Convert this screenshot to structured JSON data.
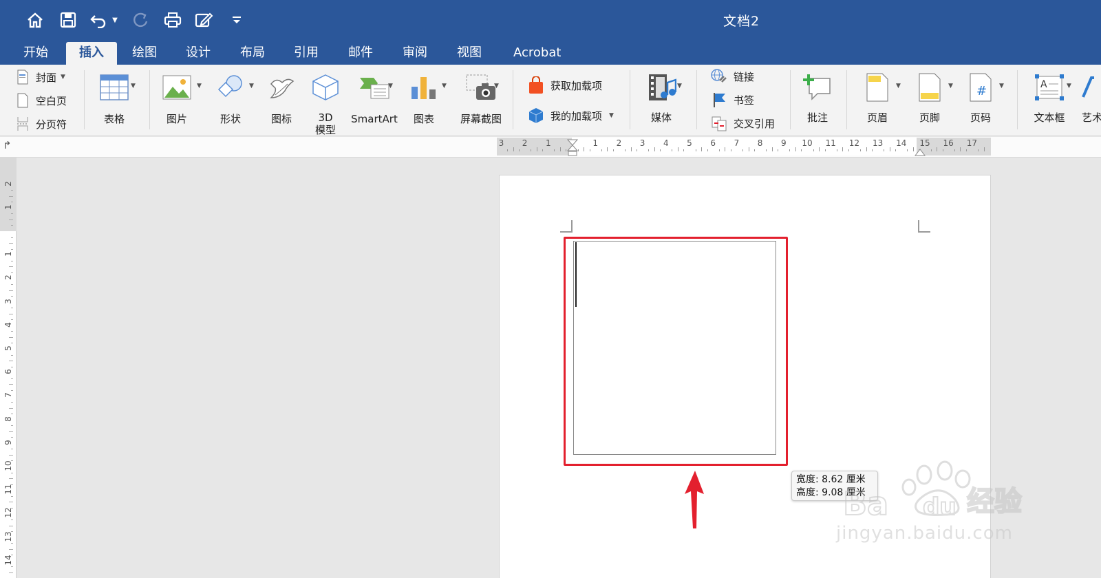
{
  "window": {
    "title": "文档2"
  },
  "quick_access": {
    "icons": [
      "home-icon",
      "save-icon",
      "undo-icon",
      "undo-dropdown-icon",
      "redo-icon",
      "print-icon",
      "edit-icon",
      "customize-icon"
    ]
  },
  "tabs": [
    {
      "label": "开始",
      "active": false
    },
    {
      "label": "插入",
      "active": true
    },
    {
      "label": "绘图",
      "active": false
    },
    {
      "label": "设计",
      "active": false
    },
    {
      "label": "布局",
      "active": false
    },
    {
      "label": "引用",
      "active": false
    },
    {
      "label": "邮件",
      "active": false
    },
    {
      "label": "审阅",
      "active": false
    },
    {
      "label": "视图",
      "active": false
    },
    {
      "label": "Acrobat",
      "active": false
    }
  ],
  "ribbon": {
    "pages_group": {
      "cover": "封面",
      "blank": "空白页",
      "page_break": "分页符"
    },
    "table": "表格",
    "picture": "图片",
    "shapes": "形状",
    "icons": "图标",
    "model3d_line1": "3D",
    "model3d_line2": "模型",
    "smartart": "SmartArt",
    "chart": "图表",
    "screenshot": "屏幕截图",
    "get_addins": "获取加载项",
    "my_addins": "我的加载项",
    "media": "媒体",
    "link": "链接",
    "bookmark": "书签",
    "cross_ref": "交叉引用",
    "comment": "批注",
    "header": "页眉",
    "footer": "页脚",
    "page_number": "页码",
    "textbox": "文本框",
    "wordart": "艺术"
  },
  "ruler": {
    "h_numbers": [
      "3",
      "2",
      "1",
      "1",
      "2",
      "3",
      "4",
      "5",
      "6",
      "7",
      "8",
      "9",
      "10",
      "11",
      "12",
      "13",
      "14",
      "15",
      "16",
      "17"
    ],
    "v_numbers": [
      "2",
      "1",
      "1",
      "2",
      "3",
      "4",
      "5",
      "6",
      "7",
      "8",
      "9",
      "10",
      "11",
      "12",
      "13",
      "14"
    ]
  },
  "tooltip": {
    "width": "宽度: 8.62 厘米",
    "height": "高度: 9.08 厘米"
  },
  "watermark": {
    "brand": "Bai du 经验",
    "url": "jingyan.baidu.com"
  },
  "colors": {
    "title_bar": "#2b579a",
    "highlight": "#e3202e"
  }
}
